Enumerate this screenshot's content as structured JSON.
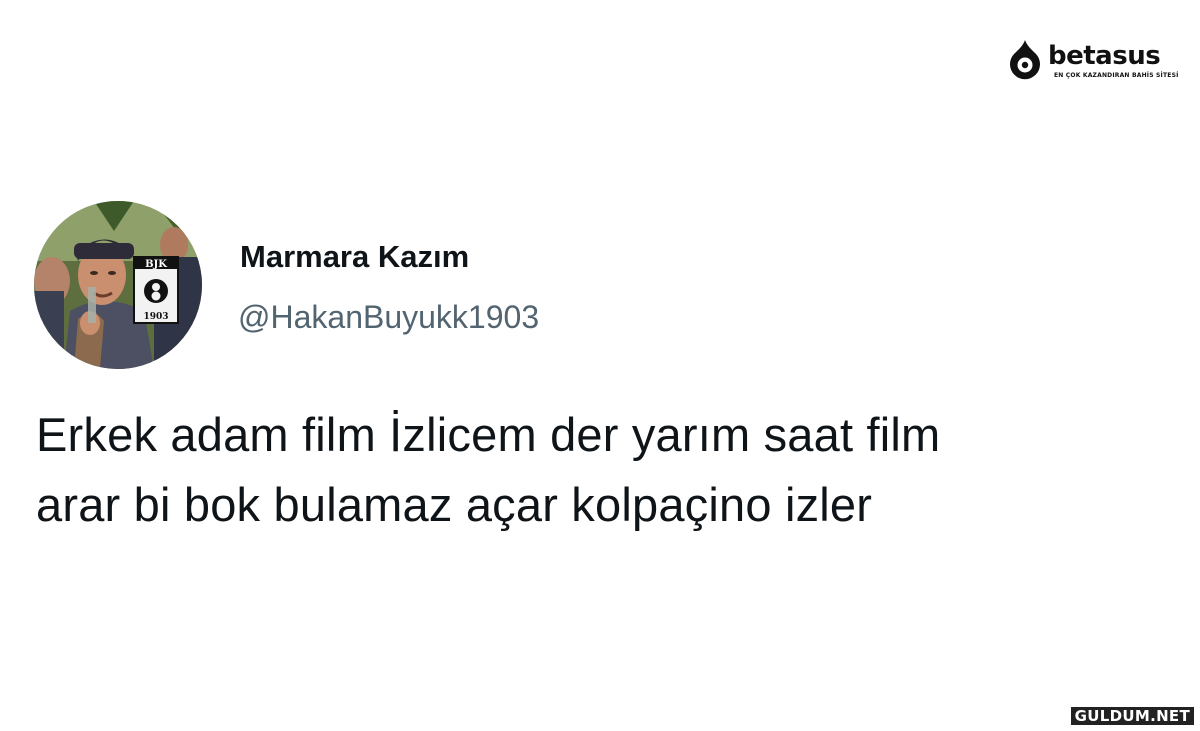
{
  "brand": {
    "name": "betasus",
    "tagline": "EN ÇOK KAZANDIRAN BAHİS SİTESİ",
    "icon": "betasus-logo-icon"
  },
  "tweet": {
    "avatar": {
      "icon": "avatar-photo",
      "badge_top": "BJK",
      "badge_year": "1903"
    },
    "display_name": "Marmara Kazım",
    "handle": "@HakanBuyukk1903",
    "text_lines": [
      "Erkek adam film İzlicem der yarım saat film",
      "arar bi bok bulamaz açar kolpaçino izler"
    ]
  },
  "watermark": {
    "text": "GULDUM.NET"
  },
  "colors": {
    "background": "#ffffff",
    "text_primary": "#0f1419",
    "text_secondary": "#536471"
  }
}
